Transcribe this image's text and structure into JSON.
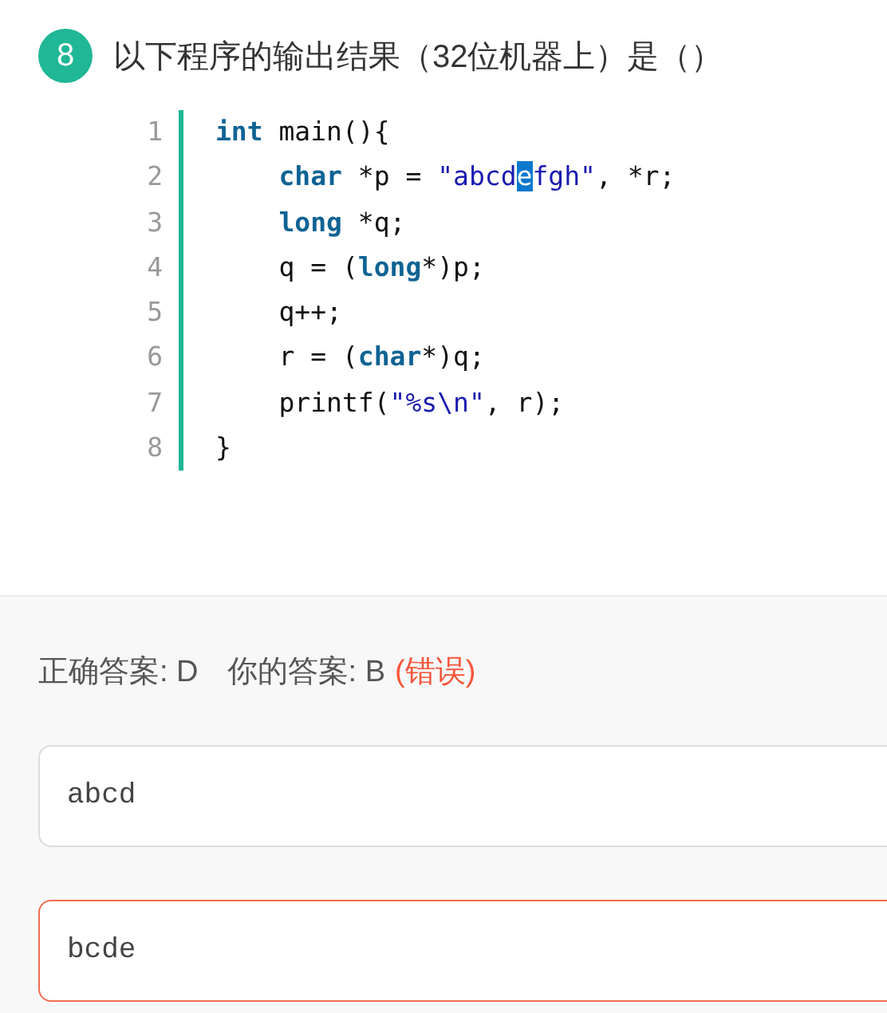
{
  "question": {
    "number": "8",
    "title": "以下程序的输出结果（32位机器上）是（）"
  },
  "code": [
    {
      "number": "1",
      "indented": false,
      "tokens": [
        {
          "text": "int",
          "kind": "keyword"
        },
        {
          "text": " main(){",
          "kind": "plain"
        }
      ]
    },
    {
      "number": "2",
      "indented": true,
      "tokens": [
        {
          "text": "char",
          "kind": "keyword"
        },
        {
          "text": " *p = ",
          "kind": "plain"
        },
        {
          "text": "\"abcd",
          "kind": "string"
        },
        {
          "text": "e",
          "kind": "selection"
        },
        {
          "text": "fgh\"",
          "kind": "string"
        },
        {
          "text": ", *r;",
          "kind": "plain"
        }
      ]
    },
    {
      "number": "3",
      "indented": true,
      "tokens": [
        {
          "text": "long",
          "kind": "keyword"
        },
        {
          "text": " *q;",
          "kind": "plain"
        }
      ]
    },
    {
      "number": "4",
      "indented": true,
      "tokens": [
        {
          "text": "q = (",
          "kind": "plain"
        },
        {
          "text": "long",
          "kind": "keyword"
        },
        {
          "text": "*)p;",
          "kind": "plain"
        }
      ]
    },
    {
      "number": "5",
      "indented": true,
      "tokens": [
        {
          "text": "q++;",
          "kind": "plain"
        }
      ]
    },
    {
      "number": "6",
      "indented": true,
      "tokens": [
        {
          "text": "r = (",
          "kind": "plain"
        },
        {
          "text": "char",
          "kind": "keyword"
        },
        {
          "text": "*)q;",
          "kind": "plain"
        }
      ]
    },
    {
      "number": "7",
      "indented": true,
      "tokens": [
        {
          "text": "printf(",
          "kind": "plain"
        },
        {
          "text": "\"%s\\n\"",
          "kind": "string"
        },
        {
          "text": ", r);",
          "kind": "plain"
        }
      ]
    },
    {
      "number": "8",
      "indented": false,
      "tokens": [
        {
          "text": "}",
          "kind": "plain"
        }
      ]
    }
  ],
  "answer": {
    "correct": "正确答案: D",
    "yours": "你的答案: B",
    "verdict": "(错误)",
    "wrong": true
  },
  "options": [
    {
      "text": "abcd",
      "selected": false
    },
    {
      "text": "bcde",
      "selected": true
    }
  ]
}
